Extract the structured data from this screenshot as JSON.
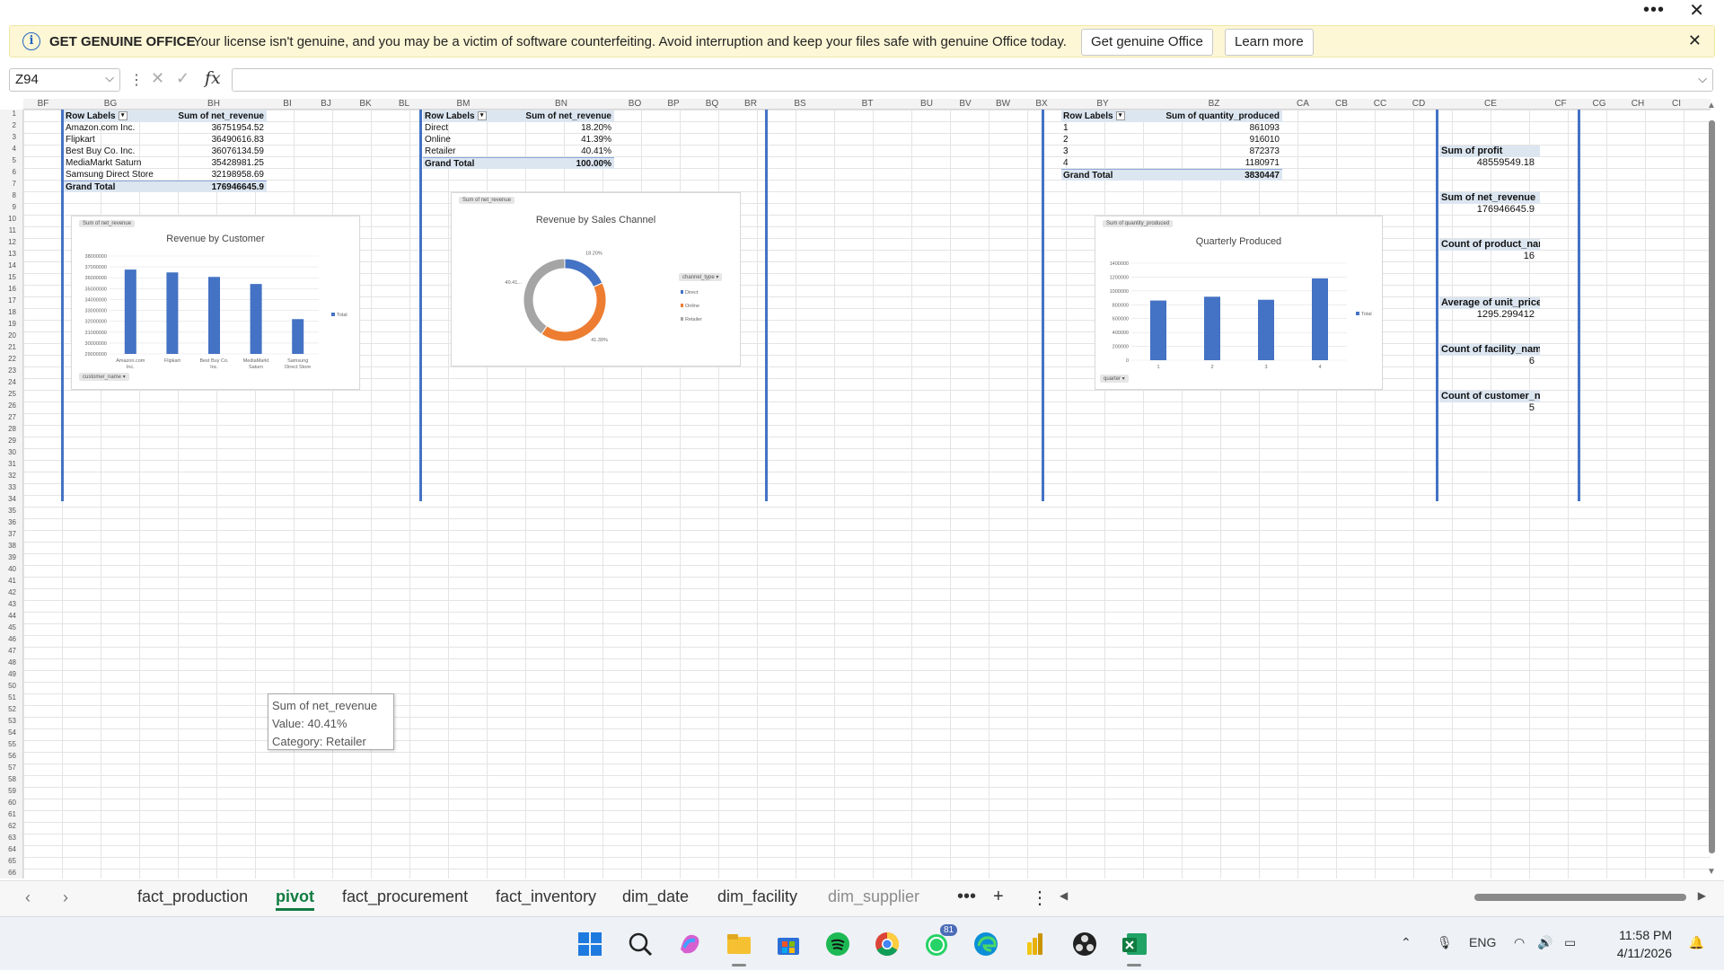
{
  "banner": {
    "title": "GET GENUINE OFFICE",
    "message": "Your license isn't genuine, and you may be a victim of software counterfeiting. Avoid interruption and keep your files safe with genuine Office today.",
    "get_button": "Get genuine Office",
    "learn_button": "Learn more"
  },
  "formula": {
    "namebox": "Z94",
    "value": ""
  },
  "columns": [
    "BF",
    "BG",
    "BH",
    "BI",
    "BJ",
    "BK",
    "BL",
    "BM",
    "BN",
    "BO",
    "BP",
    "BQ",
    "BR",
    "BS",
    "BT",
    "BU",
    "BV",
    "BW",
    "BX",
    "BY",
    "BZ",
    "CA",
    "CB",
    "CC",
    "CD",
    "CE",
    "CF",
    "CG",
    "CH",
    "CI"
  ],
  "row_count": 66,
  "pivot1": {
    "header": [
      "Row Labels",
      "Sum of net_revenue"
    ],
    "rows": [
      [
        "Amazon.com Inc.",
        "36751954.52"
      ],
      [
        "Flipkart",
        "36490616.83"
      ],
      [
        "Best Buy Co. Inc.",
        "36076134.59"
      ],
      [
        "MediaMarkt Saturn",
        "35428981.25"
      ],
      [
        "Samsung Direct Store",
        "32198958.69"
      ]
    ],
    "total": [
      "Grand Total",
      "176946645.9"
    ]
  },
  "pivot2": {
    "header": [
      "Row Labels",
      "Sum of net_revenue"
    ],
    "rows": [
      [
        "Direct",
        "18.20%"
      ],
      [
        "Online",
        "41.39%"
      ],
      [
        "Retailer",
        "40.41%"
      ]
    ],
    "total": [
      "Grand Total",
      "100.00%"
    ]
  },
  "pivot3": {
    "header": [
      "Row Labels",
      "Sum of quantity_produced"
    ],
    "rows": [
      [
        "1",
        "861093"
      ],
      [
        "2",
        "916010"
      ],
      [
        "3",
        "872373"
      ],
      [
        "4",
        "1180971"
      ]
    ],
    "total": [
      "Grand Total",
      "3830447"
    ]
  },
  "summary": [
    {
      "label": "Sum of profit",
      "value": "48559549.18"
    },
    {
      "label": "Sum of net_revenue",
      "value": "176946645.9"
    },
    {
      "label": "Count of product_name",
      "value": "16"
    },
    {
      "label": "Average of unit_price",
      "value": "1295.299412"
    },
    {
      "label": "Count of facility_name",
      "value": "6"
    },
    {
      "label": "Count of customer_name",
      "value": "5"
    }
  ],
  "chart_data": [
    {
      "type": "bar",
      "title": "Revenue by Customer",
      "field_button": "Sum of net_revenue",
      "filter_button": "customer_name",
      "categories": [
        "Amazon.com Inc.",
        "Flipkart",
        "Best Buy Co. Inc.",
        "MediaMarkt Saturn",
        "Samsung Direct Store"
      ],
      "series": [
        {
          "name": "Total",
          "values": [
            36751954.52,
            36490616.83,
            36076134.59,
            35428981.25,
            32198958.69
          ]
        }
      ],
      "yticks": [
        "38000000",
        "37000000",
        "36000000",
        "35000000",
        "34000000",
        "33000000",
        "32000000",
        "31000000",
        "30000000",
        "29000000"
      ],
      "ylim": [
        29000000,
        38000000
      ],
      "legend": "right",
      "color": "#4472c4"
    },
    {
      "type": "pie",
      "title": "Revenue by Sales Channel",
      "field_button": "Sum of net_revenue",
      "filter_button": "channel_type",
      "categories": [
        "Direct",
        "Online",
        "Retailer"
      ],
      "values": [
        18.2,
        41.39,
        40.41
      ],
      "data_labels": [
        "18.20%",
        "41.39%",
        "40.41..."
      ],
      "colors": [
        "#4472c4",
        "#ed7d31",
        "#a5a5a5"
      ],
      "legend": "right"
    },
    {
      "type": "bar",
      "title": "Quarterly Produced",
      "field_button": "Sum of quantity_produced",
      "filter_button": "quarter",
      "categories": [
        "1",
        "2",
        "3",
        "4"
      ],
      "series": [
        {
          "name": "Total",
          "values": [
            861093,
            916010,
            872373,
            1180971
          ]
        }
      ],
      "yticks": [
        "1400000",
        "1200000",
        "1000000",
        "800000",
        "600000",
        "400000",
        "200000",
        "0"
      ],
      "ylim": [
        0,
        1400000
      ],
      "legend": "right",
      "color": "#4472c4"
    }
  ],
  "tooltip": {
    "line1": "Sum of net_revenue",
    "line2": "Value: 40.41%",
    "line3": "Category: Retailer"
  },
  "sheets": [
    "fact_production",
    "pivot",
    "fact_procurement",
    "fact_inventory",
    "dim_date",
    "dim_facility",
    "dim_supplier"
  ],
  "active_sheet": "pivot",
  "taskbar": {
    "whatsapp_badge": "81",
    "lang": "ENG",
    "time": "11:58 PM",
    "date": "4/11/2026"
  }
}
